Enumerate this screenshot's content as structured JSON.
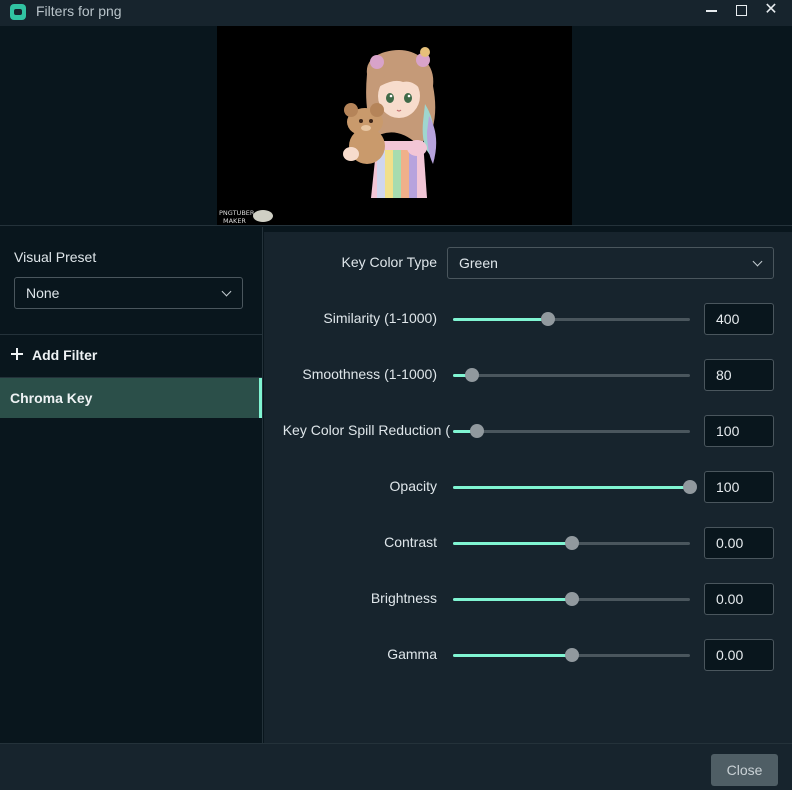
{
  "window": {
    "title": "Filters for png",
    "app_icon": "streamlabs-app-icon",
    "controls": {
      "minimize": "minimize-icon",
      "maximize": "maximize-icon",
      "close": "close-icon",
      "close_glyph": "✕"
    }
  },
  "preview": {
    "watermark_line1": "PNGTUBER",
    "watermark_line2": "MAKER"
  },
  "sidebar": {
    "visual_preset_label": "Visual Preset",
    "visual_preset_value": "None",
    "add_filter_label": "Add Filter",
    "filters": [
      {
        "label": "Chroma Key",
        "selected": true
      }
    ]
  },
  "settings": {
    "key_color_type": {
      "label": "Key Color Type",
      "value": "Green"
    },
    "sliders": [
      {
        "label": "Similarity (1-1000)",
        "value": "400",
        "fraction": 0.4
      },
      {
        "label": "Smoothness (1-1000)",
        "value": "80",
        "fraction": 0.08
      },
      {
        "label": "Key Color Spill Reduction (",
        "value": "100",
        "fraction": 0.1
      },
      {
        "label": "Opacity",
        "value": "100",
        "fraction": 1.0
      },
      {
        "label": "Contrast",
        "value": "0.00",
        "fraction": 0.5
      },
      {
        "label": "Brightness",
        "value": "0.00",
        "fraction": 0.5
      },
      {
        "label": "Gamma",
        "value": "0.00",
        "fraction": 0.5
      }
    ]
  },
  "footer": {
    "close_label": "Close"
  },
  "colors": {
    "accent": "#80f5d2",
    "panel_bg": "#17242d",
    "window_bg": "#09161d",
    "selected_filter_bg": "#2b4f49",
    "button_bg": "#4f5e65",
    "slider_track": "#4a565d",
    "slider_thumb": "#91999e"
  }
}
